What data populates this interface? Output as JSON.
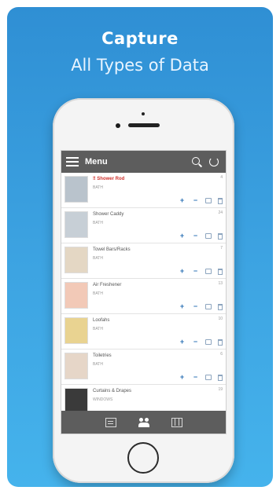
{
  "promo": {
    "headline_1": "Capture",
    "headline_2": "All Types of Data"
  },
  "app": {
    "title": "Menu",
    "items": [
      {
        "name": "‼ Shower Rod",
        "sub": "BATH",
        "count": "4",
        "alert": true,
        "thumb_color": "#b9c3cc"
      },
      {
        "name": "Shower Caddy",
        "sub": "BATH",
        "count": "24",
        "alert": false,
        "thumb_color": "#c7cfd6"
      },
      {
        "name": "Towel Bars/Racks",
        "sub": "BATH",
        "count": "7",
        "alert": false,
        "thumb_color": "#e4d7c4"
      },
      {
        "name": "Air Freshener",
        "sub": "BATH",
        "count": "13",
        "alert": false,
        "thumb_color": "#f2c9b7"
      },
      {
        "name": "Loofahs",
        "sub": "BATH",
        "count": "10",
        "alert": false,
        "thumb_color": "#e9d391"
      },
      {
        "name": "Toiletries",
        "sub": "BATH",
        "count": "6",
        "alert": false,
        "thumb_color": "#e6d6c8"
      },
      {
        "name": "Curtains & Drapes",
        "sub": "WINDOWS",
        "count": "19",
        "alert": false,
        "thumb_color": "#3a3a3a"
      }
    ],
    "action_icons": [
      "plus-icon",
      "minus-icon",
      "inventory-icon",
      "trash-icon"
    ],
    "tabs": [
      "list-icon",
      "users-icon",
      "grid-icon"
    ],
    "colors": {
      "background_top": "#2f8fd4",
      "background_bottom": "#45b3ec",
      "toolbar": "#5d5d5d",
      "accent": "#2b71b5",
      "alert": "#d0322d"
    }
  }
}
